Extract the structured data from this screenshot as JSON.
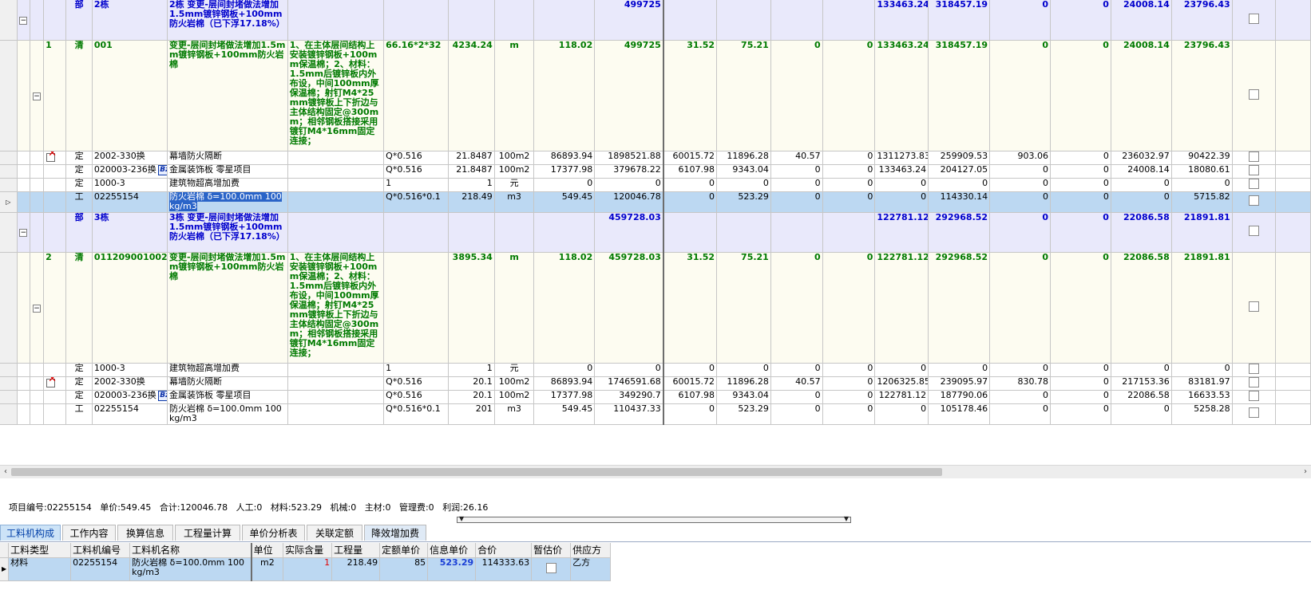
{
  "grid": {
    "rows": [
      {
        "type": "bu",
        "seq": "",
        "kind": "部",
        "code": "2栋",
        "name": "2栋 变更-层间封堵做法增加1.5mm镀锌钢板+100mm防火岩棉（已下浮17.18%）",
        "feature": "",
        "expr": "",
        "qty": "",
        "unit": "",
        "price": "",
        "total": "499725",
        "c1": "",
        "c2": "",
        "c3": "",
        "c4": "",
        "c5": "133463.24",
        "c6": "318457.19",
        "c7": "0",
        "c8": "0",
        "c9": "24008.14",
        "c10": "23796.43"
      },
      {
        "type": "qing",
        "seq": "1",
        "kind": "清",
        "code": "001",
        "name": "变更-层间封堵做法增加1.5mm镀锌钢板+100mm防火岩棉",
        "feature": "1、在主体层间结构上安装镀锌钢板+100mm保温棉；2、材料：1.5mm后镀锌板内外布设，中间100mm厚保温棉；射钉M4*25mm镀锌板上下折边与主体结构固定@300mm；相邻钢板搭接采用镀钉M4*16mm固定连接；",
        "expr": "66.16*2*32",
        "qty": "4234.24",
        "unit": "m",
        "price": "118.02",
        "total": "499725",
        "c1": "31.52",
        "c2": "75.21",
        "c3": "0",
        "c4": "0",
        "c5": "133463.24",
        "c6": "318457.19",
        "c7": "0",
        "c8": "0",
        "c9": "24008.14",
        "c10": "23796.43"
      },
      {
        "type": "ding",
        "icon": "del",
        "seq": "",
        "kind": "定",
        "code": "2002-330换",
        "name": "幕墙防火隔断",
        "feature": "",
        "expr": "Q*0.516",
        "qty": "21.8487",
        "unit": "100m2",
        "price": "86893.94",
        "total": "1898521.88",
        "c1": "60015.72",
        "c2": "11896.28",
        "c3": "40.57",
        "c4": "0",
        "c5": "1311273.83",
        "c6": "259909.53",
        "c7": "903.06",
        "c8": "0",
        "c9": "236032.97",
        "c10": "90422.39"
      },
      {
        "type": "ding",
        "icon": "bz",
        "seq": "",
        "kind": "定",
        "code": "020003-236换",
        "name": "金属装饰板 零星项目",
        "feature": "",
        "expr": "Q*0.516",
        "qty": "21.8487",
        "unit": "100m2",
        "price": "17377.98",
        "total": "379678.22",
        "c1": "6107.98",
        "c2": "9343.04",
        "c3": "0",
        "c4": "0",
        "c5": "133463.24",
        "c6": "204127.05",
        "c7": "0",
        "c8": "0",
        "c9": "24008.14",
        "c10": "18080.61"
      },
      {
        "type": "ding",
        "seq": "",
        "kind": "定",
        "code": "1000-3",
        "name": "建筑物超高增加费",
        "feature": "",
        "expr": "1",
        "qty": "1",
        "unit": "元",
        "price": "0",
        "total": "0",
        "c1": "0",
        "c2": "0",
        "c3": "0",
        "c4": "0",
        "c5": "0",
        "c6": "0",
        "c7": "0",
        "c8": "0",
        "c9": "0",
        "c10": "0"
      },
      {
        "type": "sel",
        "seq": "",
        "kind": "工",
        "code": "02255154",
        "name": "防火岩棉 δ=100.0mm 100kg/m3",
        "feature": "",
        "expr": "Q*0.516*0.1",
        "qty": "218.49",
        "unit": "m3",
        "price": "549.45",
        "total": "120046.78",
        "c1": "0",
        "c2": "523.29",
        "c3": "0",
        "c4": "0",
        "c5": "0",
        "c6": "114330.14",
        "c7": "0",
        "c8": "0",
        "c9": "0",
        "c10": "5715.82"
      },
      {
        "type": "bu",
        "seq": "",
        "kind": "部",
        "code": "3栋",
        "name": "3栋 变更-层间封堵做法增加1.5mm镀锌钢板+100mm防火岩棉（已下浮17.18%）",
        "feature": "",
        "expr": "",
        "qty": "",
        "unit": "",
        "price": "",
        "total": "459728.03",
        "c1": "",
        "c2": "",
        "c3": "",
        "c4": "",
        "c5": "122781.12",
        "c6": "292968.52",
        "c7": "0",
        "c8": "0",
        "c9": "22086.58",
        "c10": "21891.81"
      },
      {
        "type": "qing",
        "seq": "2",
        "kind": "清",
        "code": "011209001002",
        "name": "变更-层间封堵做法增加1.5mm镀锌钢板+100mm防火岩棉",
        "feature": "1、在主体层间结构上安装镀锌钢板+100mm保温棉；2、材料：1.5mm后镀锌板内外布设，中间100mm厚保温棉；射钉M4*25mm镀锌板上下折边与主体结构固定@300mm；相邻钢板搭接采用镀钉M4*16mm固定连接；",
        "expr": "",
        "qty": "3895.34",
        "unit": "m",
        "price": "118.02",
        "total": "459728.03",
        "c1": "31.52",
        "c2": "75.21",
        "c3": "0",
        "c4": "0",
        "c5": "122781.12",
        "c6": "292968.52",
        "c7": "0",
        "c8": "0",
        "c9": "22086.58",
        "c10": "21891.81"
      },
      {
        "type": "ding",
        "seq": "",
        "kind": "定",
        "code": "1000-3",
        "name": "建筑物超高增加费",
        "feature": "",
        "expr": "1",
        "qty": "1",
        "unit": "元",
        "price": "0",
        "total": "0",
        "c1": "0",
        "c2": "0",
        "c3": "0",
        "c4": "0",
        "c5": "0",
        "c6": "0",
        "c7": "0",
        "c8": "0",
        "c9": "0",
        "c10": "0"
      },
      {
        "type": "ding",
        "icon": "del",
        "seq": "",
        "kind": "定",
        "code": "2002-330换",
        "name": "幕墙防火隔断",
        "feature": "",
        "expr": "Q*0.516",
        "qty": "20.1",
        "unit": "100m2",
        "price": "86893.94",
        "total": "1746591.68",
        "c1": "60015.72",
        "c2": "11896.28",
        "c3": "40.57",
        "c4": "0",
        "c5": "1206325.85",
        "c6": "239095.97",
        "c7": "830.78",
        "c8": "0",
        "c9": "217153.36",
        "c10": "83181.97"
      },
      {
        "type": "ding",
        "icon": "bz",
        "seq": "",
        "kind": "定",
        "code": "020003-236换",
        "name": "金属装饰板 零星项目",
        "feature": "",
        "expr": "Q*0.516",
        "qty": "20.1",
        "unit": "100m2",
        "price": "17377.98",
        "total": "349290.7",
        "c1": "6107.98",
        "c2": "9343.04",
        "c3": "0",
        "c4": "0",
        "c5": "122781.12",
        "c6": "187790.06",
        "c7": "0",
        "c8": "0",
        "c9": "22086.58",
        "c10": "16633.53"
      },
      {
        "type": "ding",
        "seq": "",
        "kind": "工",
        "code": "02255154",
        "name": "防火岩棉 δ=100.0mm 100kg/m3",
        "feature": "",
        "expr": "Q*0.516*0.1",
        "qty": "201",
        "unit": "m3",
        "price": "549.45",
        "total": "110437.33",
        "c1": "0",
        "c2": "523.29",
        "c3": "0",
        "c4": "0",
        "c5": "0",
        "c6": "105178.46",
        "c7": "0",
        "c8": "0",
        "c9": "0",
        "c10": "5258.28"
      }
    ]
  },
  "status": {
    "code_label": "项目编号:02255154",
    "price_label": "单价:549.45",
    "total_label": "合计:120046.78",
    "labor_label": "人工:0",
    "material_label": "材料:523.29",
    "machine_label": "机械:0",
    "main_material_label": "主材:0",
    "management_label": "管理费:0",
    "profit_label": "利润:26.16"
  },
  "tabs": [
    "工料机构成",
    "工作内容",
    "换算信息",
    "工程量计算",
    "单价分析表",
    "关联定额",
    "降效增加费"
  ],
  "subgrid": {
    "headers": [
      "工料类型",
      "工料机编号",
      "工料机名称",
      "单位",
      "实际含量",
      "工程量",
      "定额单价",
      "信息单价",
      "合价",
      "暂估价",
      "供应方"
    ],
    "row": {
      "type": "材料",
      "code": "02255154",
      "name": "防火岩棉 δ=100.0mm 100kg/m3",
      "unit": "m2",
      "content": "1",
      "qty": "218.49",
      "quota_price": "85",
      "info_price": "523.29",
      "total": "114333.63",
      "supplier": "乙方"
    }
  },
  "colors": {
    "bu_bg": "#e9e9fb",
    "bu_text": "#0000cc",
    "qing_bg": "#fdfcf1",
    "qing_text": "#007a00",
    "selected_bg": "#bcd8f2",
    "info_price": "#1a3fd6"
  }
}
